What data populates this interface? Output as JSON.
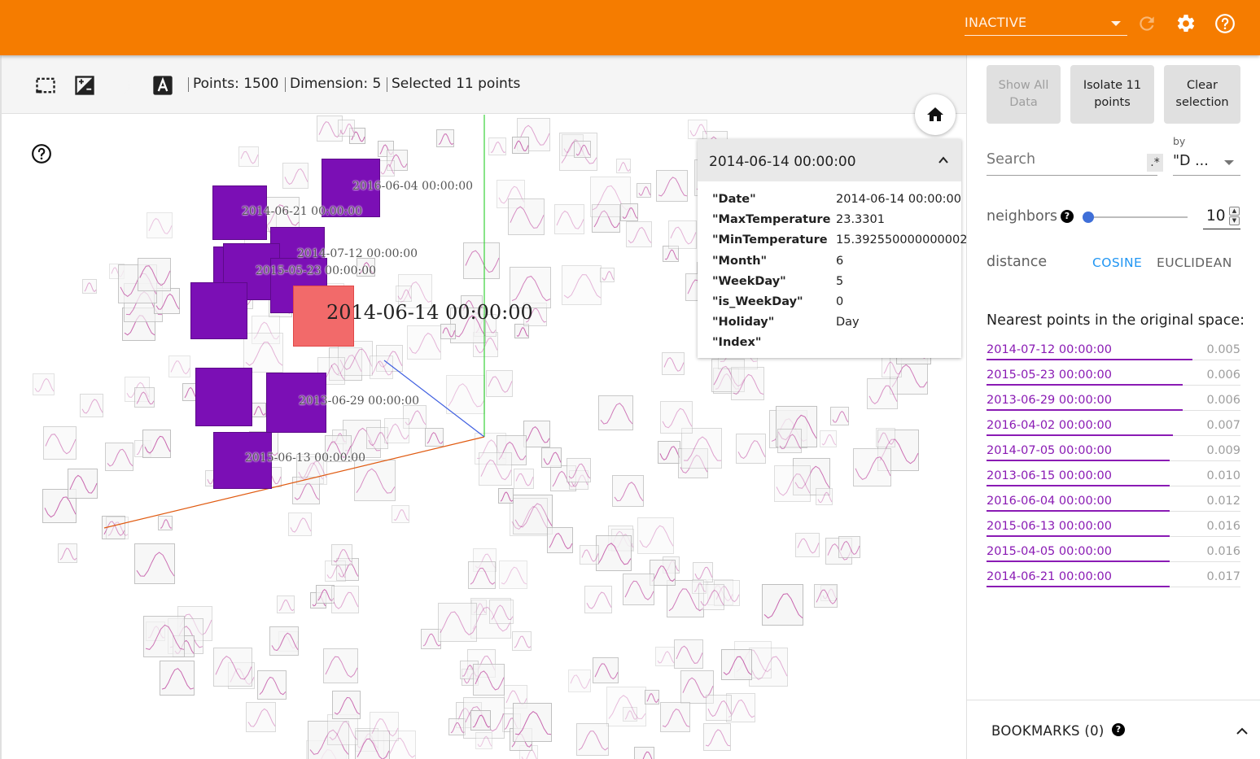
{
  "header": {
    "run_status": "INACTIVE",
    "icons": [
      "refresh-icon",
      "gear-icon",
      "help-icon"
    ],
    "accent_color": "#f57c00"
  },
  "toolbar": {
    "icons": [
      "box-select-icon",
      "night-mode-icon",
      "contrast-icon",
      "label-toggle-icon"
    ],
    "points": "Points: 1500",
    "dimension": "Dimension: 5",
    "selected": "Selected 11 points"
  },
  "canvas": {
    "highlighted_label": "2014-06-14 00:00:00",
    "selected_labels": [
      "2016-06-04 00:00:00",
      "2014-06-21 00:00:00",
      "2014-07-12 00:00:00",
      "2015-05-23 00:00:00",
      "2013-06-29 00:00:00",
      "2015-06-13 00:00:00"
    ],
    "selection_color": "#7b0fb5",
    "highlight_color": "#f26a6a"
  },
  "metadata_card": {
    "title": "2014-06-14 00:00:00",
    "rows": [
      {
        "key": "\"Date\"",
        "value": "2014-06-14 00:00:00"
      },
      {
        "key": "\"MaxTemperature",
        "value": "23.3301"
      },
      {
        "key": "\"MinTemperature",
        "value": "15.392550000000002"
      },
      {
        "key": "\"Month\"",
        "value": "6"
      },
      {
        "key": "\"WeekDay\"",
        "value": "5"
      },
      {
        "key": "\"is_WeekDay\"",
        "value": "0"
      },
      {
        "key": "\"Holiday\"",
        "value": "Day"
      },
      {
        "key": "\"Index\"",
        "value": ""
      }
    ]
  },
  "panel": {
    "show_all_label": "Show All Data",
    "isolate_label": "Isolate 11 points",
    "clear_label": "Clear selection",
    "search_placeholder": "Search",
    "regex_label": ".*",
    "by_label": "by",
    "by_value": "\"D ...",
    "neighbors_label": "neighbors",
    "neighbors_value": "10",
    "neighbors_fraction": 0.0,
    "distance_label": "distance",
    "distance_options": [
      "COSINE",
      "EUCLIDEAN"
    ],
    "distance_selected": "COSINE",
    "nearest_title": "Nearest points in the original space:",
    "nearest": [
      {
        "name": "2014-07-12 00:00:00",
        "value": "0.005"
      },
      {
        "name": "2015-05-23 00:00:00",
        "value": "0.006"
      },
      {
        "name": "2013-06-29 00:00:00",
        "value": "0.006"
      },
      {
        "name": "2016-04-02 00:00:00",
        "value": "0.007"
      },
      {
        "name": "2014-07-05 00:00:00",
        "value": "0.009"
      },
      {
        "name": "2013-06-15 00:00:00",
        "value": "0.010"
      },
      {
        "name": "2016-06-04 00:00:00",
        "value": "0.012"
      },
      {
        "name": "2015-06-13 00:00:00",
        "value": "0.016"
      },
      {
        "name": "2015-04-05 00:00:00",
        "value": "0.016"
      },
      {
        "name": "2014-06-21 00:00:00",
        "value": "0.017"
      }
    ],
    "bookmarks_label": "BOOKMARKS (0)"
  }
}
